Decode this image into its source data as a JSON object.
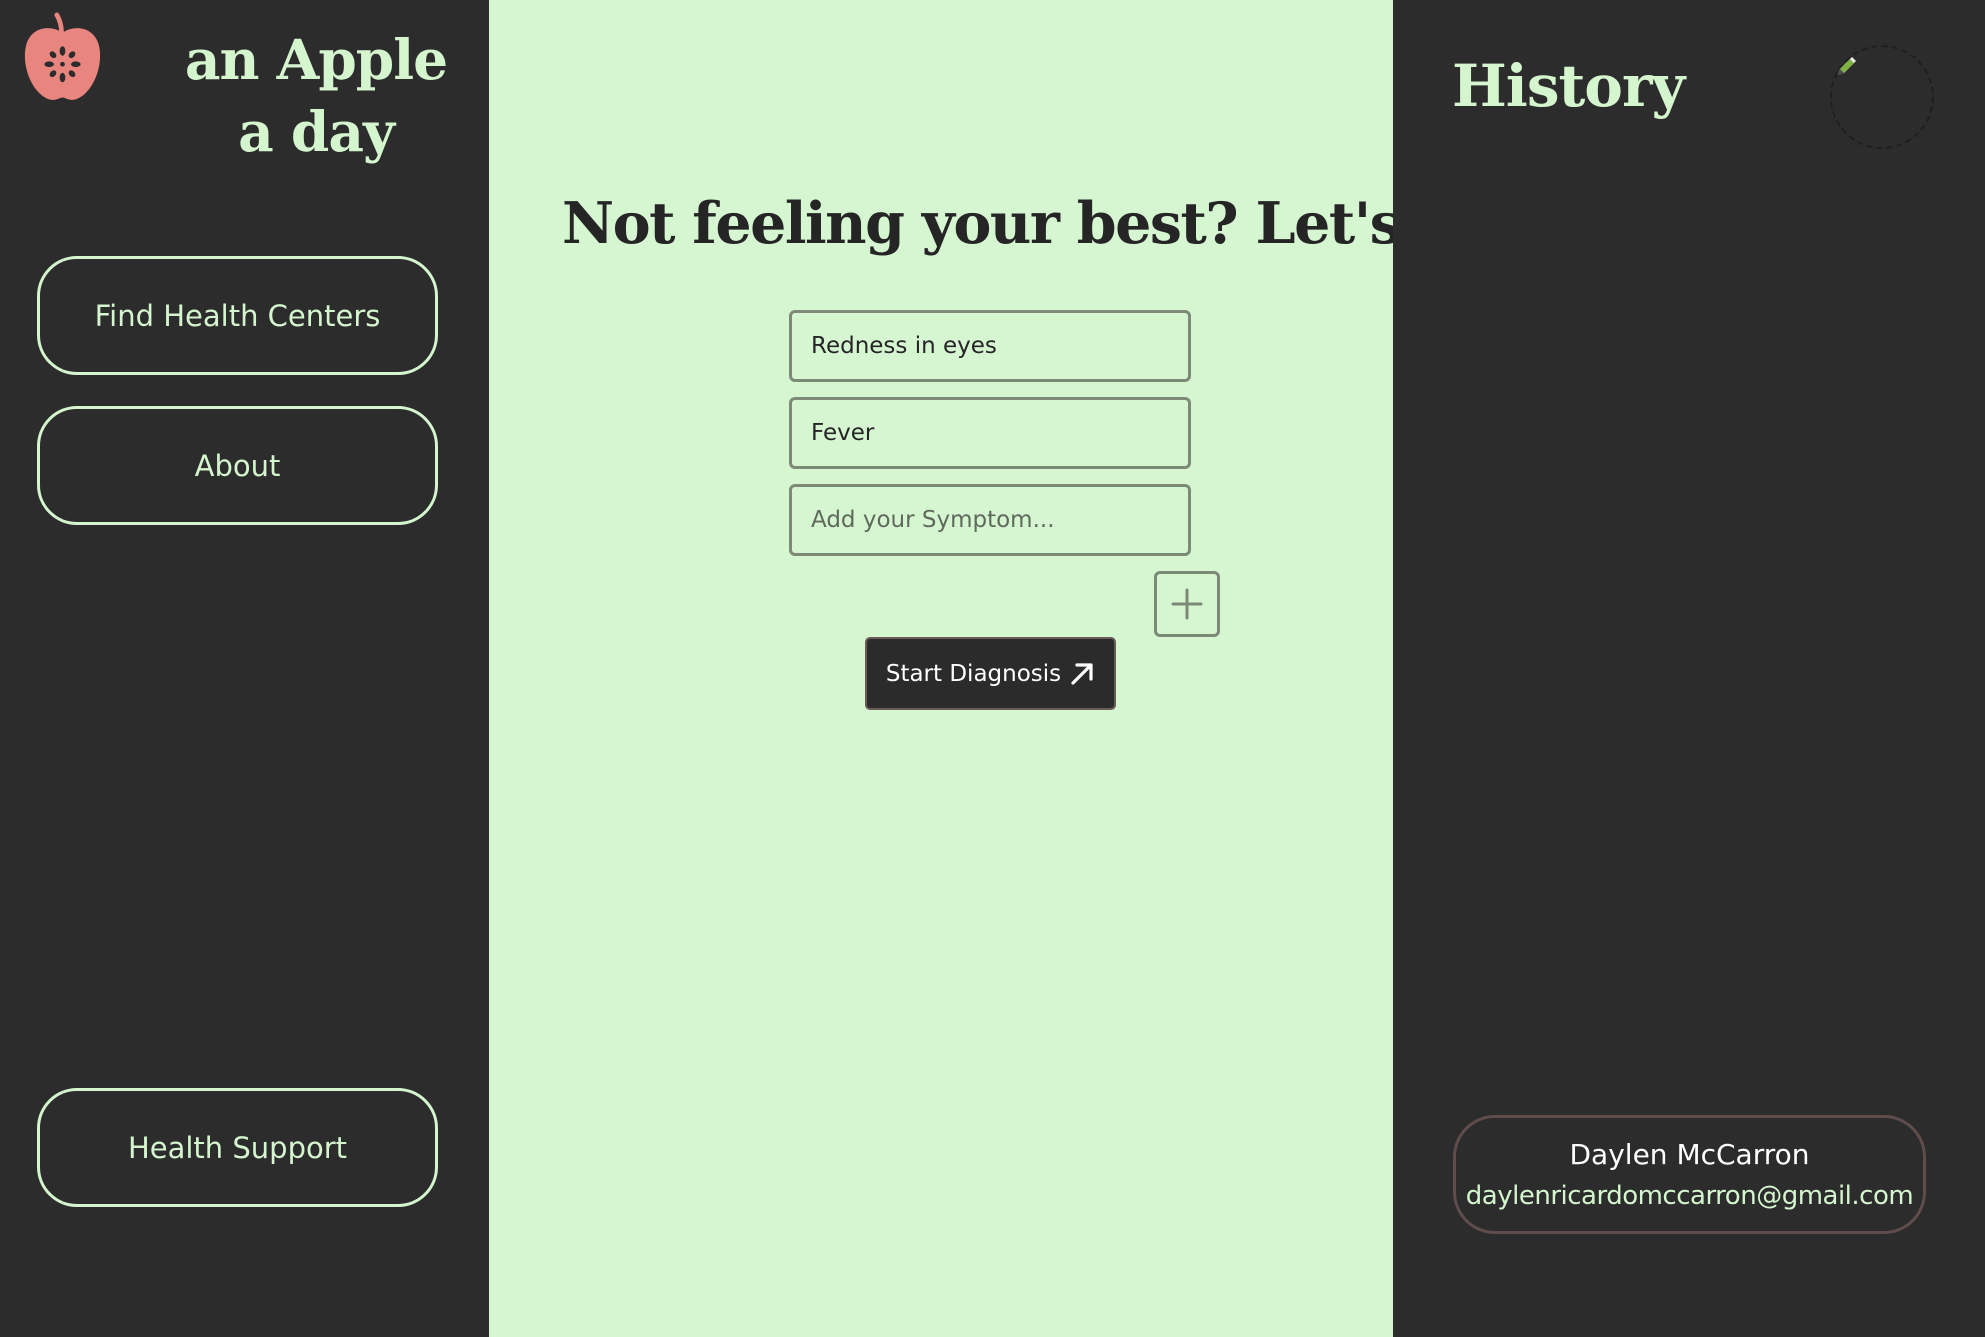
{
  "brand": {
    "title": "an Apple a day",
    "icon": "apple-icon",
    "colors": {
      "apple": "#e8857f",
      "accent": "#d4f5ce"
    }
  },
  "sidebar": {
    "items": [
      {
        "label": "Find Health Centers"
      },
      {
        "label": "About"
      },
      {
        "label": "Health Support"
      }
    ]
  },
  "main": {
    "headline": "Not feeling your best? Let's help",
    "symptoms": [
      {
        "value": "Redness in eyes",
        "placeholder": ""
      },
      {
        "value": "Fever",
        "placeholder": ""
      },
      {
        "value": "",
        "placeholder": "Add your Symptom..."
      }
    ],
    "add_icon": "plus-icon",
    "start_label": "Start Diagnosis",
    "start_icon": "arrow-up-right-icon",
    "background": "#d6f6d2"
  },
  "history": {
    "title": "History",
    "edit_icon": "pen-icon"
  },
  "user": {
    "name": "Daylen McCarron",
    "email": "daylenricardomccarron@gmail.com"
  }
}
